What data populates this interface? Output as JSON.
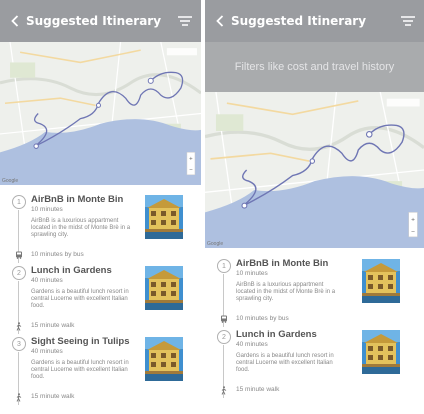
{
  "header": {
    "title": "Suggested Itinerary",
    "back_icon": "chevron-left-icon",
    "filter_icon": "filter-lines-icon"
  },
  "colors": {
    "header_bg": "#9a9ca0",
    "banner_bg": "#a9abad",
    "water": "#aec0e0",
    "route": "#6f76b4"
  },
  "filters_banner": "Filters like cost and travel history",
  "map": {
    "credit": "Google"
  },
  "itinerary": [
    {
      "num": "1",
      "name": "AirBnB in Monte Bin",
      "duration": "10 minutes",
      "description": "AirBnB is a luxurious appartment located in the midst of Monte Brè in a sprawling city."
    },
    {
      "num": "2",
      "name": "Lunch in Gardens",
      "duration": "40 minutes",
      "description": "Gardens is a beautiful lunch resort in central Lucerne with excellent Italian food."
    },
    {
      "num": "3",
      "name": "Sight Seeing in Tulips",
      "duration": "40 minutes",
      "description": "Gardens is a beautiful lunch resort in central Lucerne with excellent Italian food."
    }
  ],
  "travel": [
    {
      "icon": "bus-icon",
      "text": "10 minutes by bus"
    },
    {
      "icon": "walk-icon",
      "text": "15 minute walk"
    },
    {
      "icon": "walk-icon",
      "text": "15 minute walk"
    }
  ]
}
